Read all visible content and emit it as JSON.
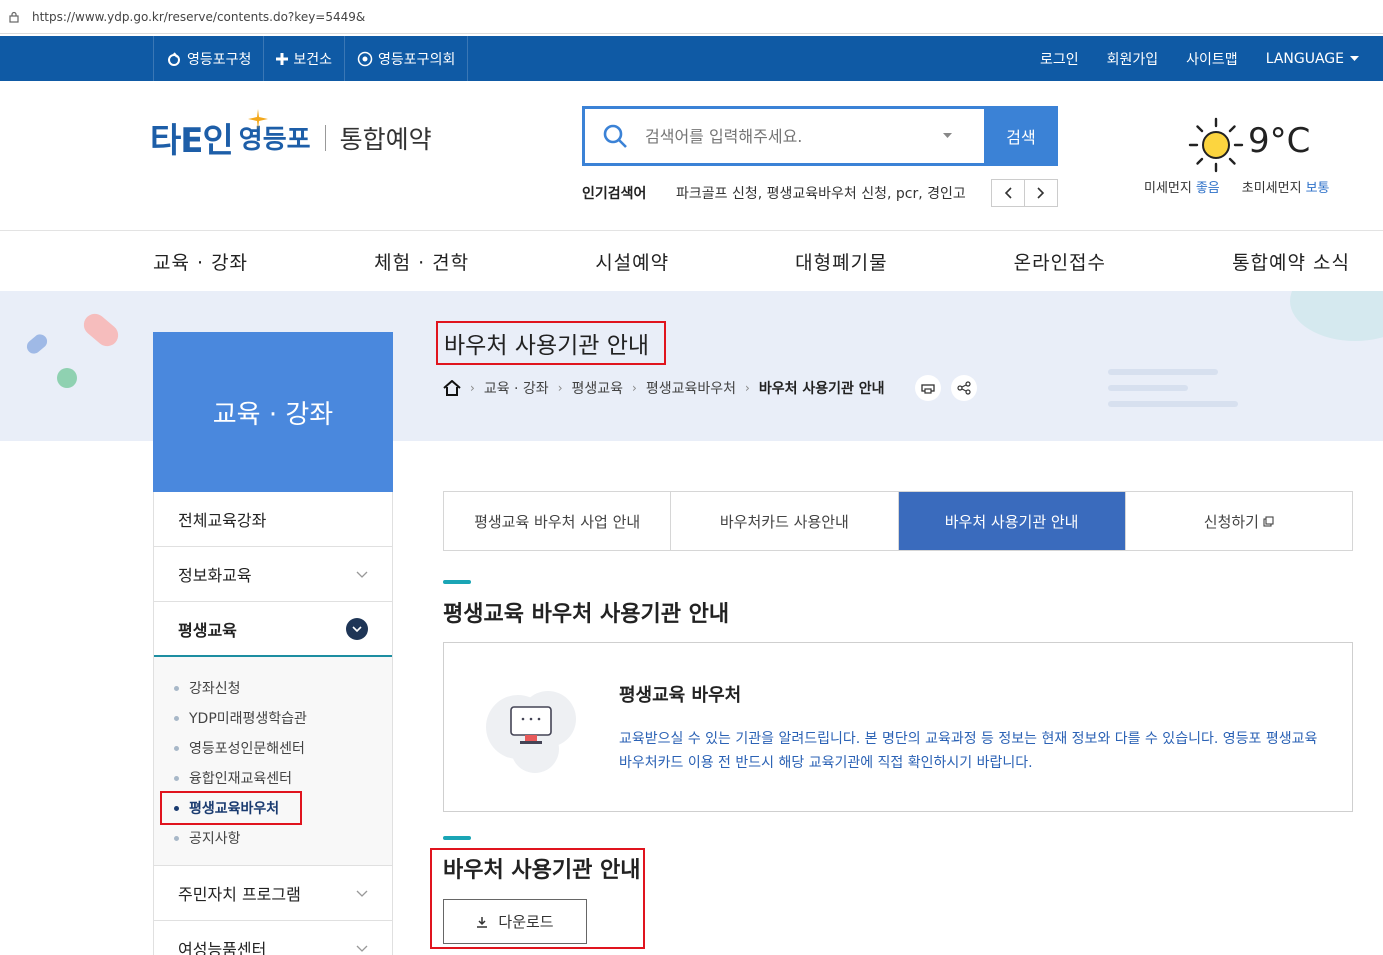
{
  "browser": {
    "url": "https://www.ydp.go.kr/reserve/contents.do?key=5449&"
  },
  "topbar": {
    "sites": [
      "영등포구청",
      "보건소",
      "영등포구의회"
    ],
    "links": [
      "로그인",
      "회원가입",
      "사이트맵"
    ],
    "language": "LANGUAGE"
  },
  "header": {
    "logo_main": "타Ε인",
    "logo_sub": "영등포",
    "logo_title": "통합예약",
    "search_placeholder": "검색어를 입력해주세요.",
    "search_button": "검색",
    "popular_label": "인기검색어",
    "popular_keywords": "파크골프 신청, 평생교육바우처 신청, pcr, 경인고",
    "weather": {
      "temp": "9°C",
      "dust_label": "미세먼지",
      "dust_value": "좋음",
      "fine_dust_label": "초미세먼지",
      "fine_dust_value": "보통"
    }
  },
  "gnb": [
    "교육 · 강좌",
    "체험 · 견학",
    "시설예약",
    "대형폐기물",
    "온라인접수",
    "통합예약 소식"
  ],
  "sidebar": {
    "title": "교육 · 강좌",
    "items": [
      "전체교육강좌",
      "정보화교육",
      "평생교육",
      "주민자치 프로그램",
      "여성능품센터"
    ],
    "subs": [
      "강좌신청",
      "YDP미래평생학습관",
      "영등포성인문해센터",
      "융합인재교육센터",
      "평생교육바우처",
      "공지사항"
    ]
  },
  "page": {
    "title": "바우처 사용기관 안내",
    "breadcrumb": [
      "교육 · 강좌",
      "평생교육",
      "평생교육바우처",
      "바우처 사용기관 안내"
    ],
    "tabs": [
      "평생교육 바우처 사업 안내",
      "바우처카드 사용안내",
      "바우처 사용기관 안내",
      "신청하기"
    ],
    "section1_title": "평생교육 바우처 사용기관 안내",
    "info_title": "평생교육 바우처",
    "info_desc": "교육받으실 수 있는 기관을 알려드립니다. 본 명단의 교육과정 등 정보는 현재 정보와 다를 수 있습니다. 영등포 평생교육 바우처카드 이용 전 반드시 해당 교육기관에 직접 확인하시기 바랍니다.",
    "section2_title": "바우처 사용기관 안내",
    "download_label": "다운로드"
  },
  "colors": {
    "topbar": "#0f5aa5",
    "accent": "#3b82d6",
    "sidebar_head": "#4a88dd",
    "active_tab": "#3a6bbd",
    "highlight": "#e0141e"
  }
}
